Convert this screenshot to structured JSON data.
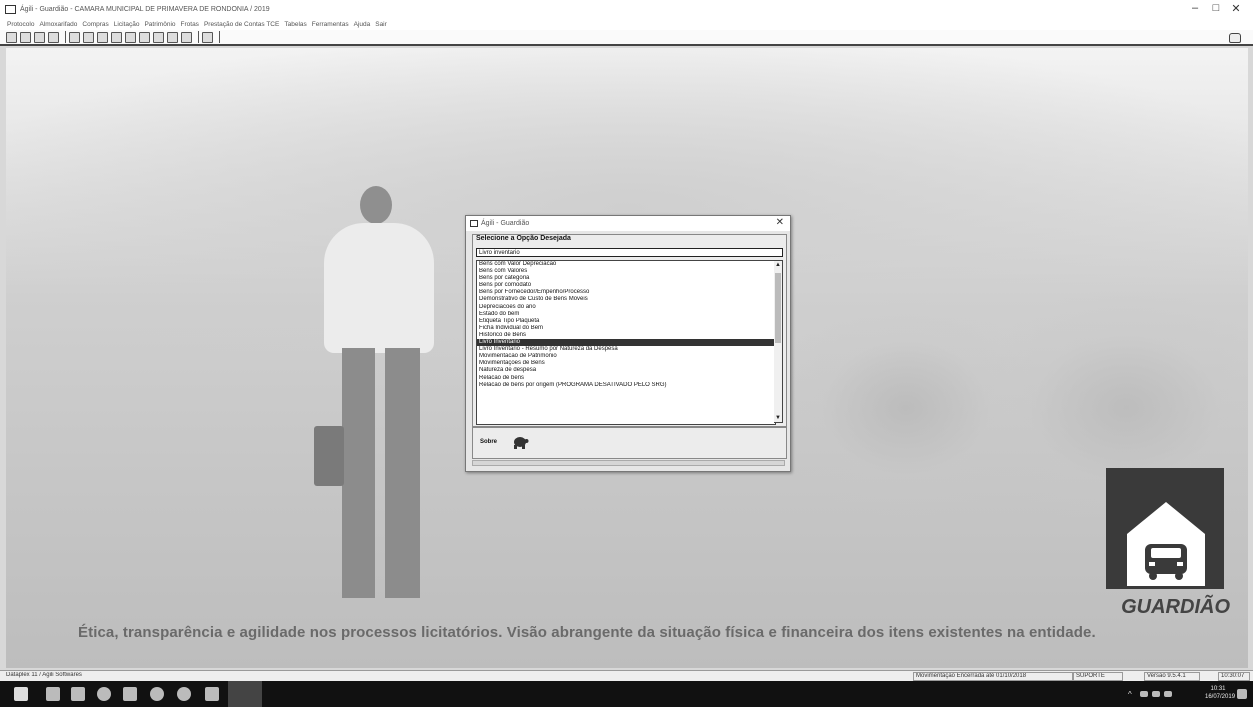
{
  "window": {
    "title": "Ágili - Guardião - CAMARA MUNICIPAL DE PRIMAVERA DE RONDONIA / 2019",
    "controls": [
      "–",
      "□",
      "✕"
    ]
  },
  "menu": {
    "items": [
      "Protocolo",
      "Almoxarifado",
      "Compras",
      "Licitação",
      "Patrimônio",
      "Frotas",
      "Prestação de Contas TCE",
      "Tabelas",
      "Ferramentas",
      "Ajuda",
      "Sair"
    ]
  },
  "dialog": {
    "title": "Ágili - Guardião",
    "close": "✕",
    "prompt": "Selecione a Opção Desejada",
    "input_value": "Livro inventario",
    "items": [
      "Bens com Valor Depreciacao",
      "Bens com Valores",
      "Bens por categoria",
      "Bens por comodato",
      "Bens por Fornecedor/Empenho/Processo",
      "Demonstrativo de Custo de Bens Moveis",
      "Depreciacoes do ano",
      "Estado do bem",
      "Etiqueta Tipo Plaqueta",
      "Ficha Individual do Bem",
      "Historico de Bens",
      "Livro Inventario",
      "Livro Inventario - Resumo por Natureza da Despesa",
      "Movimentacao de Patrimonio",
      "Movimentações de Bens",
      "Natureza de despesa",
      "Relacao de bens",
      "Relacao de bens por origem (PROGRAMA DESATIVADO PELO SRG)"
    ],
    "selected_index": 11,
    "scroll_up": "▲",
    "scroll_down": "▼",
    "footer_label": "Sobre"
  },
  "background": {
    "logo_text": "GUARDIÃO",
    "tagline": "Ética, transparência e agilidade nos processos licitatórios. Visão abrangente da situação física e financeira dos itens existentes na entidade."
  },
  "statusbar": {
    "left": "Dataplex 11 / Agili Softwares",
    "movement": "Movimentação Encerrada até 01/10/2018",
    "user": "SUPORTE",
    "version": "Versão 9.5.4.1",
    "clock": "10:30:07"
  },
  "taskbar": {
    "tray_icons": "^",
    "time": "10:31",
    "date": "16/07/2019"
  },
  "colors": {
    "selection": "#333333",
    "taskbar": "#111111",
    "logo_box": "#3a3a3a"
  }
}
